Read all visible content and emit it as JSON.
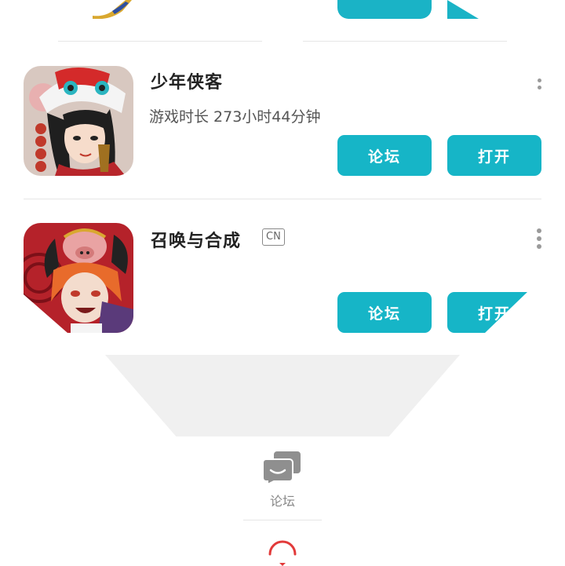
{
  "games": [
    {
      "title": "少年侠客",
      "playtime": "游戏时长 273小时44分钟",
      "buttons": {
        "forum": "论坛",
        "open": "打开"
      }
    },
    {
      "title": "召唤与合成",
      "tag": "CN",
      "buttons": {
        "forum": "论坛",
        "open": "打开"
      }
    }
  ],
  "bottom_nav": {
    "forum_label": "论坛"
  },
  "colors": {
    "accent": "#16b5c7",
    "divider": "#e6e6e6"
  },
  "icons": [
    "more-vertical-icon",
    "forum-chat-icon",
    "loading-spinner-icon"
  ]
}
